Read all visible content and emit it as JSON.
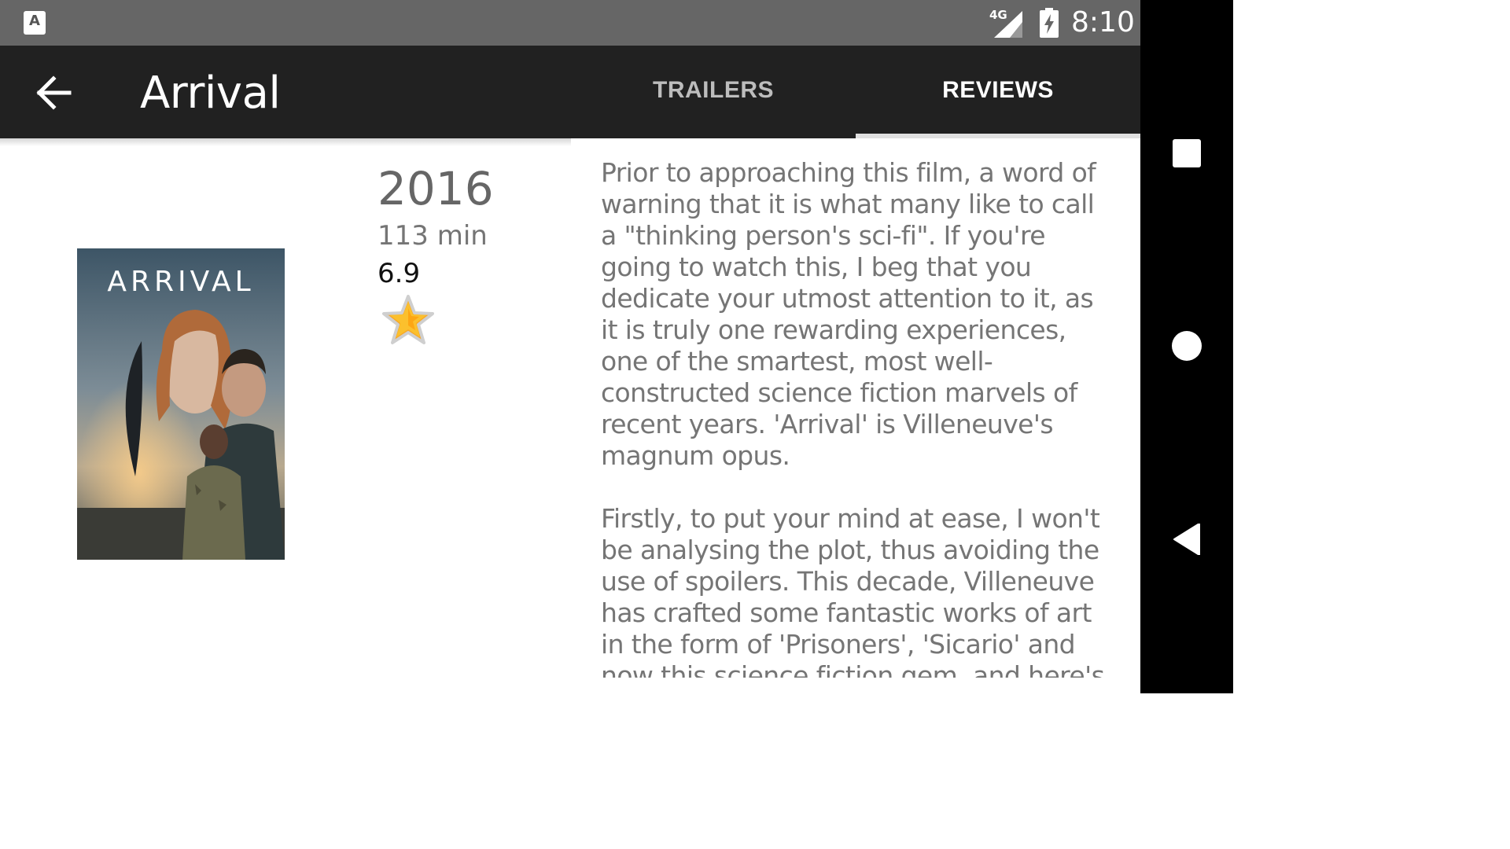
{
  "status_bar": {
    "network": "4G",
    "time": "8:10",
    "app_icon": "a-notification-icon",
    "icons": [
      "signal-icon",
      "battery-charging-icon"
    ]
  },
  "app_bar": {
    "title": "Arrival",
    "back_icon": "arrow-back-icon",
    "tabs": [
      {
        "label": "TRAILERS",
        "selected": false
      },
      {
        "label": "REVIEWS",
        "selected": true
      }
    ]
  },
  "movie": {
    "poster_title": "ARRIVAL",
    "year": "2016",
    "runtime": "113 min",
    "rating": "6.9",
    "favorite_icon": "star-icon"
  },
  "review": {
    "paragraphs": [
      "Prior to approaching this film, a word of warning that it is what many like to call a \"thinking person's sci-fi\". If you're going to watch this, I beg that you dedicate your utmost attention to it, as it is truly one rewarding experiences, one of the smartest, most well-constructed science fiction marvels of recent years. 'Arrival' is Villeneuve's magnum opus.",
      "Firstly, to put your mind at ease, I won't be analysing the plot, thus avoiding the use of spoilers. This decade, Villeneuve has crafted some fantastic works of art in the form of 'Prisoners', 'Sicario' and now this science fiction gem, and here's hoping his career further develops with more"
    ]
  },
  "nav_bar": {
    "buttons": [
      "recents-square-icon",
      "home-circle-icon",
      "back-triangle-icon"
    ]
  },
  "colors": {
    "status_bar": "#666666",
    "app_bar": "#212121",
    "tab_inactive": "#bdbdbd",
    "text_gray": "#757575",
    "star": "#f9a825"
  }
}
